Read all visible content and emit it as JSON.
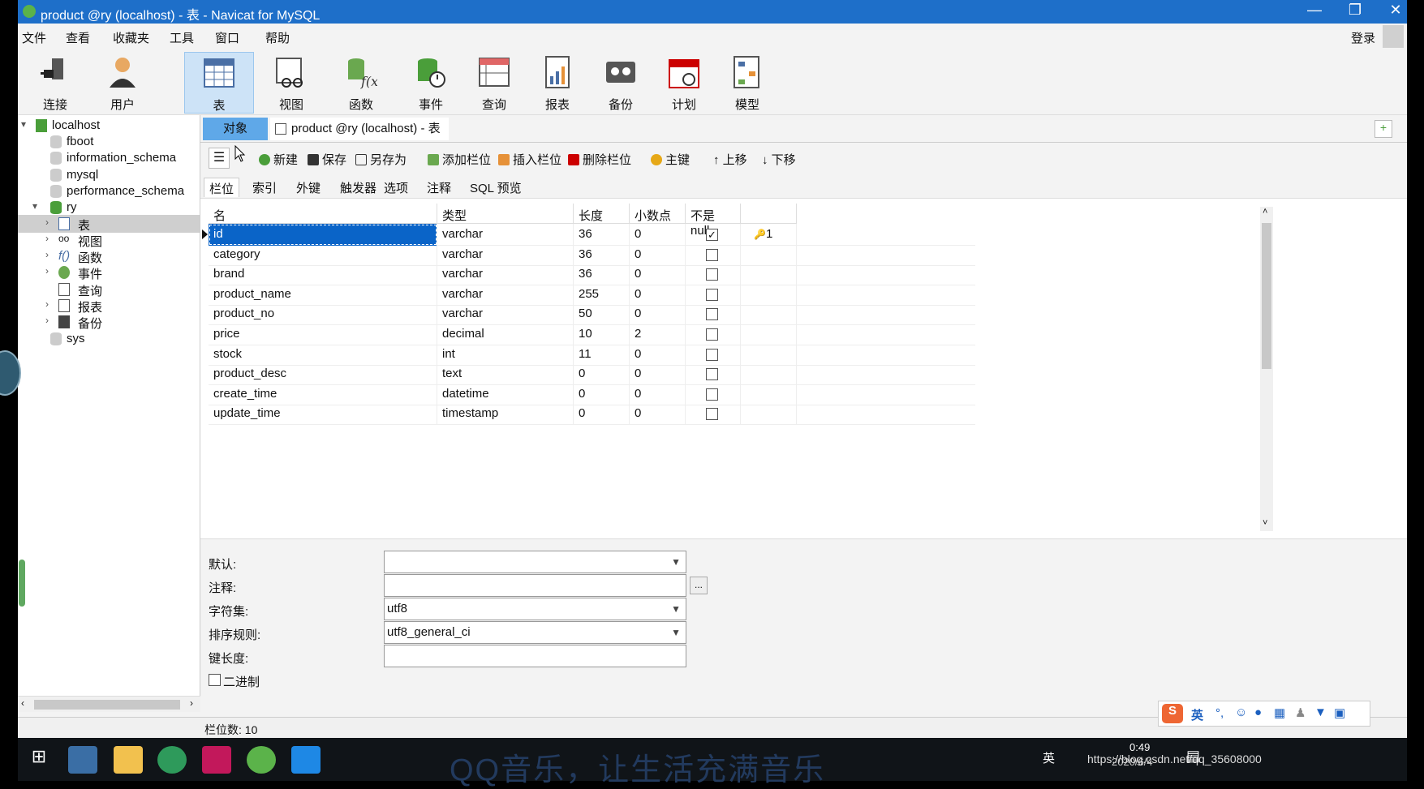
{
  "window": {
    "title": "product @ry (localhost) - 表 - Navicat for MySQL",
    "minimize": "—",
    "restore": "❐",
    "close": "✕"
  },
  "menu": {
    "items": [
      "文件",
      "查看",
      "收藏夹",
      "工具",
      "窗口",
      "帮助"
    ],
    "login": "登录"
  },
  "toolbar": {
    "buttons": [
      {
        "label": "连接",
        "icon": "plug-icon"
      },
      {
        "label": "用户",
        "icon": "user-icon"
      },
      {
        "label": "表",
        "icon": "table-icon"
      },
      {
        "label": "视图",
        "icon": "view-icon"
      },
      {
        "label": "函数",
        "icon": "function-icon"
      },
      {
        "label": "事件",
        "icon": "event-icon"
      },
      {
        "label": "查询",
        "icon": "query-icon"
      },
      {
        "label": "报表",
        "icon": "report-icon"
      },
      {
        "label": "备份",
        "icon": "backup-icon"
      },
      {
        "label": "计划",
        "icon": "schedule-icon"
      },
      {
        "label": "模型",
        "icon": "model-icon"
      }
    ]
  },
  "sidebar": {
    "connection": "localhost",
    "databases": [
      "fboot",
      "information_schema",
      "mysql",
      "performance_schema"
    ],
    "active_db": "ry",
    "ry_children": [
      "表",
      "视图",
      "函数",
      "事件",
      "查询",
      "报表",
      "备份"
    ],
    "last_db": "sys"
  },
  "tabs": {
    "object": "对象",
    "doc": "product @ry (localhost) - 表"
  },
  "editor_toolbar": {
    "new": "新建",
    "save": "保存",
    "save_as": "另存为",
    "add_field": "添加栏位",
    "insert_field": "插入栏位",
    "delete_field": "删除栏位",
    "primary_key": "主键",
    "move_up": "上移",
    "move_down": "下移"
  },
  "subtabs": [
    "栏位",
    "索引",
    "外键",
    "触发器",
    "选项",
    "注释",
    "SQL 预览"
  ],
  "grid": {
    "headers": [
      "名",
      "类型",
      "长度",
      "小数点",
      "不是 null",
      ""
    ],
    "rows": [
      {
        "name": "id",
        "type": "varchar",
        "length": "36",
        "decimal": "0",
        "not_null": true,
        "key": "1"
      },
      {
        "name": "category",
        "type": "varchar",
        "length": "36",
        "decimal": "0",
        "not_null": false,
        "key": ""
      },
      {
        "name": "brand",
        "type": "varchar",
        "length": "36",
        "decimal": "0",
        "not_null": false,
        "key": ""
      },
      {
        "name": "product_name",
        "type": "varchar",
        "length": "255",
        "decimal": "0",
        "not_null": false,
        "key": ""
      },
      {
        "name": "product_no",
        "type": "varchar",
        "length": "50",
        "decimal": "0",
        "not_null": false,
        "key": ""
      },
      {
        "name": "price",
        "type": "decimal",
        "length": "10",
        "decimal": "2",
        "not_null": false,
        "key": ""
      },
      {
        "name": "stock",
        "type": "int",
        "length": "11",
        "decimal": "0",
        "not_null": false,
        "key": ""
      },
      {
        "name": "product_desc",
        "type": "text",
        "length": "0",
        "decimal": "0",
        "not_null": false,
        "key": ""
      },
      {
        "name": "create_time",
        "type": "datetime",
        "length": "0",
        "decimal": "0",
        "not_null": false,
        "key": ""
      },
      {
        "name": "update_time",
        "type": "timestamp",
        "length": "0",
        "decimal": "0",
        "not_null": false,
        "key": ""
      }
    ]
  },
  "props": {
    "default_label": "默认:",
    "default_value": "",
    "comment_label": "注释:",
    "comment_value": "",
    "comment_btn": "...",
    "charset_label": "字符集:",
    "charset_value": "utf8",
    "collation_label": "排序规则:",
    "collation_value": "utf8_general_ci",
    "keylen_label": "键长度:",
    "keylen_value": "",
    "binary_label": "二进制"
  },
  "status": {
    "field_count": "栏位数: 10"
  },
  "taskbar": {
    "watermark": "QQ音乐，让生活充满音乐",
    "lang": "英",
    "time": "0:49",
    "url_overlay": "https://blog.csdn.net/qq_35608000",
    "date": "2020/6/4"
  },
  "ime": {
    "lang": "英"
  }
}
